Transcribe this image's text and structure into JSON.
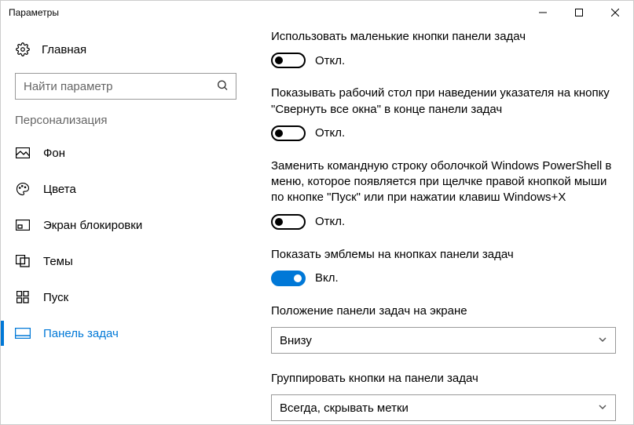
{
  "window": {
    "title": "Параметры"
  },
  "sidebar": {
    "home": "Главная",
    "search_placeholder": "Найти параметр",
    "section": "Персонализация",
    "items": [
      {
        "label": "Фон"
      },
      {
        "label": "Цвета"
      },
      {
        "label": "Экран блокировки"
      },
      {
        "label": "Темы"
      },
      {
        "label": "Пуск"
      },
      {
        "label": "Панель задач"
      }
    ]
  },
  "toggle_states": {
    "off": "Откл.",
    "on": "Вкл."
  },
  "settings": [
    {
      "label": "Использовать маленькие кнопки панели задач",
      "type": "toggle",
      "value": false
    },
    {
      "label": "Показывать рабочий стол при наведении указателя на кнопку \"Свернуть все окна\" в конце панели задач",
      "type": "toggle",
      "value": false
    },
    {
      "label": "Заменить командную строку оболочкой Windows PowerShell в меню, которое появляется при щелчке правой кнопкой мыши по кнопке \"Пуск\" или при нажатии клавиш Windows+X",
      "type": "toggle",
      "value": false
    },
    {
      "label": "Показать эмблемы на кнопках панели задач",
      "type": "toggle",
      "value": true
    },
    {
      "label": "Положение панели задач на экране",
      "type": "select",
      "value": "Внизу"
    },
    {
      "label": "Группировать кнопки на панели задач",
      "type": "select",
      "value": "Всегда, скрывать метки"
    }
  ]
}
